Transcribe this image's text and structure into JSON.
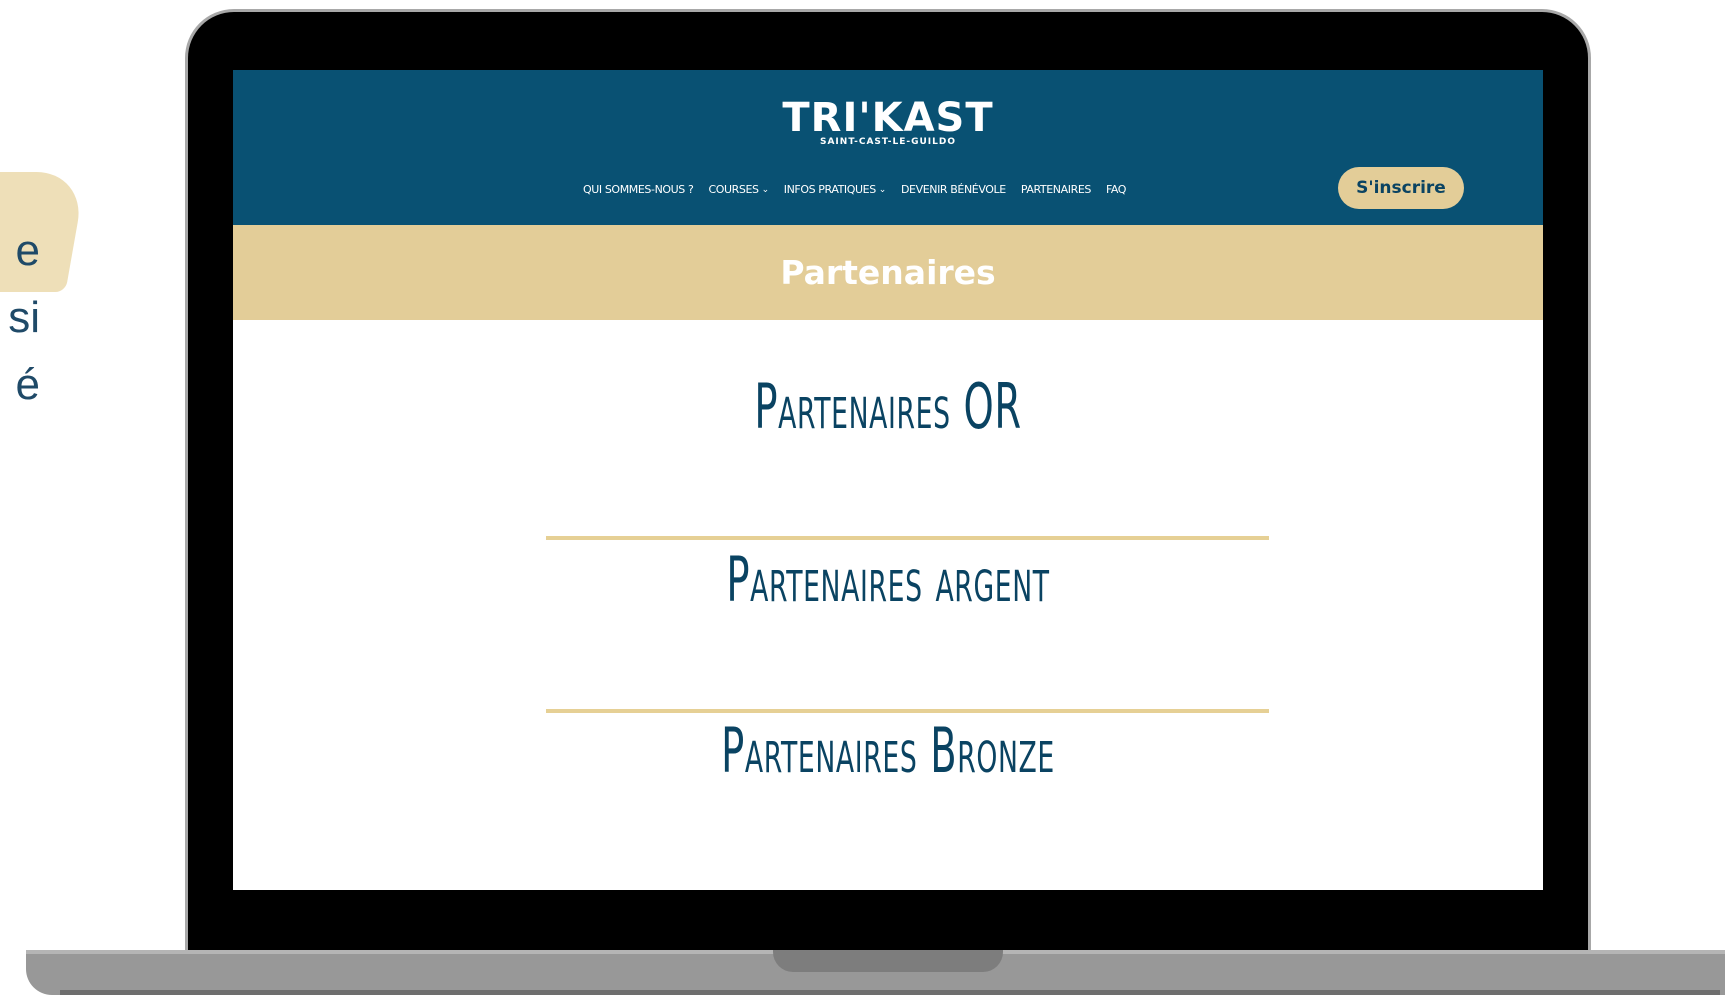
{
  "side_text": {
    "lines": [
      "e",
      "si",
      "é"
    ]
  },
  "site": {
    "logo_main": "TRI'KAST",
    "logo_sub": "SAINT-CAST-LE-GUILDO",
    "nav": [
      {
        "label": "QUI SOMMES-NOUS ?",
        "has_dropdown": false
      },
      {
        "label": "COURSES",
        "has_dropdown": true
      },
      {
        "label": "INFOS PRATIQUES",
        "has_dropdown": true
      },
      {
        "label": "DEVENIR BÉNÉVOLE",
        "has_dropdown": false
      },
      {
        "label": "PARTENAIRES",
        "has_dropdown": false
      },
      {
        "label": "FAQ",
        "has_dropdown": false
      }
    ],
    "signup_label": "S'inscrire",
    "page_title": "Partenaires",
    "sections": [
      "Partenaires OR",
      "Partenaires argent",
      "Partenaires Bronze"
    ]
  },
  "colors": {
    "header_bg": "#095173",
    "accent_gold": "#e3cd98",
    "heading_blue": "#0a4362"
  }
}
